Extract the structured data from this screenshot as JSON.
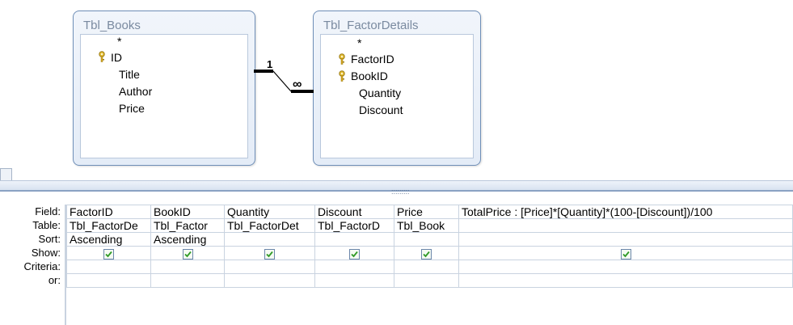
{
  "diagram": {
    "tables": [
      {
        "title": "Tbl_Books",
        "fields": [
          "*",
          "ID",
          "Title",
          "Author",
          "Price"
        ],
        "keys": [
          1
        ]
      },
      {
        "title": "Tbl_FactorDetails",
        "fields": [
          "*",
          "FactorID",
          "BookID",
          "Quantity",
          "Discount"
        ],
        "keys": [
          1,
          2
        ]
      }
    ],
    "relationship": {
      "one_label": "1",
      "many_label": "∞"
    }
  },
  "grid": {
    "row_labels": [
      "Field:",
      "Table:",
      "Sort:",
      "Show:",
      "Criteria:",
      "or:"
    ],
    "columns": [
      {
        "field": "FactorID",
        "table": "Tbl_FactorDe",
        "sort": "Ascending",
        "show": true
      },
      {
        "field": "BookID",
        "table": "Tbl_Factor",
        "sort": "Ascending",
        "show": true
      },
      {
        "field": "Quantity",
        "table": "Tbl_FactorDet",
        "sort": "",
        "show": true
      },
      {
        "field": "Discount",
        "table": "Tbl_FactorD",
        "sort": "",
        "show": true
      },
      {
        "field": "Price",
        "table": "Tbl_Book",
        "sort": "",
        "show": true
      },
      {
        "field": "TotalPrice : [Price]*[Quantity]*(100-[Discount])/100",
        "table": "",
        "sort": "",
        "show": true
      }
    ]
  }
}
